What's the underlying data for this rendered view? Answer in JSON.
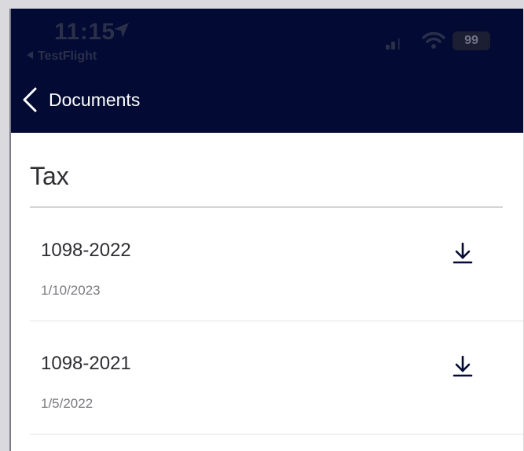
{
  "status_bar": {
    "time": "11:15",
    "back_app": "TestFlight",
    "battery": "99"
  },
  "nav": {
    "title": "Documents"
  },
  "section": {
    "title": "Tax"
  },
  "documents": [
    {
      "name": "1098-2022",
      "date": "1/10/2023"
    },
    {
      "name": "1098-2021",
      "date": "1/5/2022"
    }
  ],
  "colors": {
    "header_bg": "#030a33",
    "accent": "#030a33",
    "text_primary": "#2e2e33",
    "text_secondary": "#7b7b80"
  },
  "icons": {
    "back": "chevron-left-icon",
    "download": "download-icon",
    "location": "location-arrow-icon",
    "signal": "signal-icon",
    "wifi": "wifi-icon",
    "battery": "battery-icon"
  }
}
